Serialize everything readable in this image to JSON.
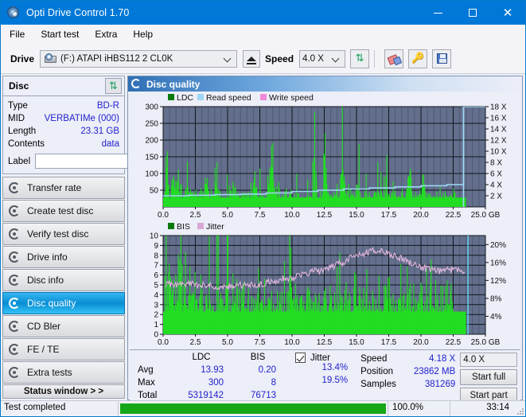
{
  "window": {
    "title": "Opti Drive Control 1.70",
    "icon": "disc-icon",
    "minimize_label": "–",
    "maximize_label": "□",
    "close_label": "✕"
  },
  "menubar": {
    "items": [
      {
        "label": "File"
      },
      {
        "label": "Start test"
      },
      {
        "label": "Extra"
      },
      {
        "label": "Help"
      }
    ]
  },
  "toolbar": {
    "drive_label": "Drive",
    "drive_value": "(F:)  ATAPI iHBS112  2 CL0K",
    "eject_icon": "eject-icon",
    "speed_label": "Speed",
    "speed_value": "4.0 X",
    "refresh_icon": "refresh-icon",
    "eraser_icon": "eraser-icon",
    "key_icon": "key-icon",
    "save_icon": "save-icon"
  },
  "sidebar": {
    "disc_panel": {
      "title": "Disc",
      "refresh_icon": "refresh-disc-icon",
      "rows": [
        {
          "key": "Type",
          "value": "BD-R"
        },
        {
          "key": "MID",
          "value": "VERBATIMe (000)"
        },
        {
          "key": "Length",
          "value": "23.31 GB"
        },
        {
          "key": "Contents",
          "value": "data"
        }
      ],
      "label_key": "Label",
      "label_value": "",
      "label_placeholder": "",
      "label_button_icon": "cd-icon"
    },
    "nav_items": [
      {
        "label": "Transfer rate",
        "icon": "disc-test-icon",
        "active": false
      },
      {
        "label": "Create test disc",
        "icon": "disc-test-icon",
        "active": false
      },
      {
        "label": "Verify test disc",
        "icon": "disc-test-icon",
        "active": false
      },
      {
        "label": "Drive info",
        "icon": "disc-test-icon",
        "active": false
      },
      {
        "label": "Disc info",
        "icon": "disc-test-icon",
        "active": false
      },
      {
        "label": "Disc quality",
        "icon": "disc-test-icon",
        "active": true
      },
      {
        "label": "CD Bler",
        "icon": "disc-test-icon",
        "active": false
      },
      {
        "label": "FE / TE",
        "icon": "disc-test-icon",
        "active": false
      },
      {
        "label": "Extra tests",
        "icon": "disc-test-icon",
        "active": false
      }
    ],
    "status_window_button": "Status window > >"
  },
  "main": {
    "panel_title": "Disc quality",
    "panel_icon": "disc-quality-icon"
  },
  "stats": {
    "col_headers": [
      "",
      "LDC",
      "BIS"
    ],
    "rows": [
      {
        "key": "Avg",
        "ldc": "13.93",
        "bis": "0.20"
      },
      {
        "key": "Max",
        "ldc": "300",
        "bis": "8"
      },
      {
        "key": "Total",
        "ldc": "5319142",
        "bis": "76713"
      }
    ],
    "jitter": {
      "checked": true,
      "label": "Jitter",
      "avg": "13.4%",
      "max": "19.5%"
    },
    "speed": {
      "key": "Speed",
      "value": "4.18 X"
    },
    "position": {
      "key": "Position",
      "value": "23862 MB"
    },
    "samples": {
      "key": "Samples",
      "value": "381269"
    },
    "speed_select": "4.0 X",
    "start_full_button": "Start full",
    "start_part_button": "Start part"
  },
  "statusbar": {
    "message": "Test completed",
    "progress_percent": "100.0%",
    "progress_value": 100,
    "elapsed": "33:14"
  },
  "colors": {
    "accent": "#0078d7",
    "plot_bg": "#636f8c",
    "ldc_green": "#22dd22",
    "bis_green": "#22dd22",
    "read_speed_blue": "#9fe0f8",
    "write_speed_pink": "#ef8fe0",
    "jitter_pink": "#e3b6dd",
    "value_blue": "#2222cc",
    "progress_green": "#16a716"
  },
  "chart_data": [
    {
      "type": "line",
      "title": "Disc quality - LDC / Read speed",
      "xlabel": "GB",
      "ylabel": "LDC",
      "y2label": "X",
      "xlim": [
        0,
        25
      ],
      "ylim": [
        0,
        300
      ],
      "y2lim": [
        0,
        18
      ],
      "xticks": [
        "0.0",
        "2.5",
        "5.0",
        "7.5",
        "10.0",
        "12.5",
        "15.0",
        "17.5",
        "20.0",
        "22.5",
        "25.0 GB"
      ],
      "yticks": [
        "50",
        "100",
        "150",
        "200",
        "250",
        "300"
      ],
      "y2ticks": [
        "2 X",
        "4 X",
        "6 X",
        "8 X",
        "10 X",
        "12 X",
        "14 X",
        "16 X",
        "18 X"
      ],
      "grid": true,
      "legend_position": "top-left",
      "legend": [
        {
          "name": "LDC",
          "color": "#0a7a0a"
        },
        {
          "name": "Read speed",
          "color": "#9fd6f5"
        },
        {
          "name": "Write speed",
          "color": "#f08ad8"
        }
      ],
      "series": [
        {
          "name": "LDC",
          "color": "#22dd22",
          "kind": "impulse",
          "x": [
            0.1,
            0.3,
            0.5,
            0.7,
            0.9,
            1.1,
            1.3,
            1.5,
            1.7,
            1.9,
            2.1,
            2.3,
            2.5,
            2.7,
            2.9,
            3.1,
            3.3,
            3.5,
            3.7,
            3.9,
            4.1,
            4.3,
            4.5,
            4.7,
            4.9,
            5.1,
            5.3,
            5.5,
            5.7,
            5.9,
            6.1,
            6.3,
            6.5,
            6.7,
            6.9,
            7.1,
            7.3,
            7.5,
            7.7,
            7.9,
            8.1,
            8.3,
            8.5,
            8.7,
            8.9,
            9.1,
            9.3,
            9.5,
            9.7,
            9.9,
            10.1,
            10.3,
            10.5,
            10.7,
            10.9,
            11.1,
            11.3,
            11.5,
            11.7,
            11.9,
            12.1,
            12.3,
            12.5,
            12.7,
            12.9,
            13.1,
            13.3,
            13.5,
            13.7,
            13.9,
            14.1,
            14.3,
            14.5,
            14.7,
            14.9,
            15.1,
            15.3,
            15.5,
            15.7,
            15.9,
            16.1,
            16.3,
            16.5,
            16.7,
            16.9,
            17.1,
            17.3,
            17.5,
            17.7,
            17.9,
            18.1,
            18.3,
            18.5,
            18.7,
            18.9,
            19.1,
            19.3,
            19.5,
            19.7,
            19.9,
            20.1,
            20.3,
            20.5,
            20.7,
            20.9,
            21.1,
            21.3,
            21.5,
            21.7,
            21.9,
            22.1,
            22.3,
            22.5,
            22.7,
            22.9,
            23.1,
            23.3,
            23.5
          ],
          "values": [
            95,
            170,
            60,
            85,
            55,
            150,
            52,
            45,
            42,
            60,
            48,
            40,
            55,
            38,
            42,
            36,
            120,
            40,
            34,
            38,
            175,
            36,
            40,
            34,
            48,
            42,
            38,
            120,
            40,
            36,
            34,
            42,
            40,
            36,
            70,
            90,
            44,
            38,
            36,
            40,
            42,
            130,
            180,
            36,
            34,
            38,
            36,
            40,
            34,
            36,
            38,
            34,
            40,
            36,
            34,
            38,
            34,
            36,
            250,
            34,
            36,
            38,
            300,
            40,
            36,
            34,
            36,
            38,
            34,
            190,
            36,
            34,
            38,
            36,
            34,
            120,
            36,
            34,
            40,
            36,
            34,
            36,
            38,
            34,
            36,
            34,
            100,
            36,
            34,
            38,
            36,
            34,
            36,
            38,
            34,
            130,
            36,
            34,
            36,
            38,
            120,
            36,
            34,
            36,
            38,
            34,
            36,
            34,
            38,
            36,
            34,
            36,
            34,
            36
          ]
        },
        {
          "name": "Read speed",
          "color": "#9fd6f5",
          "kind": "step",
          "x": [
            0,
            2,
            4,
            6,
            8,
            10,
            12,
            14,
            16,
            18,
            20,
            22,
            23.3
          ],
          "values": [
            2.0,
            2.1,
            2.2,
            2.3,
            2.5,
            2.8,
            3.0,
            3.2,
            3.4,
            3.6,
            3.8,
            4.0,
            18.0
          ]
        }
      ]
    },
    {
      "type": "line",
      "title": "Disc quality - BIS / Jitter",
      "xlabel": "GB",
      "ylabel": "BIS",
      "y2label": "%",
      "xlim": [
        0,
        25
      ],
      "ylim": [
        0,
        10
      ],
      "y2lim": [
        0,
        22
      ],
      "xticks": [
        "0.0",
        "2.5",
        "5.0",
        "7.5",
        "10.0",
        "12.5",
        "15.0",
        "17.5",
        "20.0",
        "22.5",
        "25.0 GB"
      ],
      "yticks": [
        "0",
        "1",
        "2",
        "3",
        "4",
        "5",
        "6",
        "7",
        "8",
        "9",
        "10"
      ],
      "y2ticks": [
        "4%",
        "8%",
        "12%",
        "16%",
        "20%"
      ],
      "grid": true,
      "legend_position": "top-left",
      "legend": [
        {
          "name": "BIS",
          "color": "#0a7a0a"
        },
        {
          "name": "Jitter",
          "color": "#d9a8d4"
        }
      ],
      "series": [
        {
          "name": "BIS",
          "color": "#22dd22",
          "kind": "impulse",
          "x": [
            0.1,
            0.3,
            0.5,
            0.7,
            0.9,
            1.1,
            1.3,
            1.5,
            1.7,
            1.9,
            2.1,
            2.3,
            2.5,
            2.7,
            2.9,
            3.1,
            3.3,
            3.5,
            3.7,
            3.9,
            4.1,
            4.3,
            4.5,
            4.7,
            4.9,
            5.1,
            5.3,
            5.5,
            5.7,
            5.9,
            6.1,
            6.3,
            6.5,
            6.7,
            6.9,
            7.1,
            7.3,
            7.5,
            7.7,
            7.9,
            8.1,
            8.3,
            8.5,
            8.7,
            8.9,
            9.1,
            9.3,
            9.5,
            9.7,
            9.9,
            10.1,
            10.3,
            10.5,
            10.7,
            10.9,
            11.1,
            11.3,
            11.5,
            11.7,
            11.9,
            12.1,
            12.3,
            12.5,
            12.7,
            12.9,
            13.1,
            13.3,
            13.5,
            13.7,
            13.9,
            14.1,
            14.3,
            14.5,
            14.7,
            14.9,
            15.1,
            15.3,
            15.5,
            15.7,
            15.9,
            16.1,
            16.3,
            16.5,
            16.7,
            16.9,
            17.1,
            17.3,
            17.5,
            17.7,
            17.9,
            18.1,
            18.3,
            18.5,
            18.7,
            18.9,
            19.1,
            19.3,
            19.5,
            19.7,
            19.9,
            20.1,
            20.3,
            20.5,
            20.7,
            20.9,
            21.1,
            21.3,
            21.5,
            21.7,
            21.9,
            22.1,
            22.3,
            22.5,
            22.7,
            22.9,
            23.1,
            23.3,
            23.5
          ],
          "values": [
            6,
            5,
            6,
            8,
            4,
            7,
            7,
            4,
            5,
            4,
            3,
            4,
            3,
            4,
            5,
            3,
            4,
            3,
            4,
            3,
            4,
            5,
            3,
            4,
            7,
            3,
            4,
            3,
            4,
            3,
            4,
            3,
            5,
            3,
            4,
            3,
            4,
            3,
            4,
            5,
            3,
            4,
            3,
            4,
            3,
            4,
            3,
            4,
            3,
            5,
            3,
            4,
            3,
            4,
            3,
            4,
            5,
            3,
            4,
            3,
            4,
            3,
            4,
            3,
            5,
            3,
            4,
            3,
            4,
            3,
            5,
            3,
            4,
            3,
            6,
            3,
            4,
            3,
            4,
            3,
            6,
            3,
            4,
            5,
            3,
            4,
            5,
            5,
            3,
            4,
            3,
            4,
            3,
            4,
            3,
            4,
            3,
            4,
            3,
            4,
            5,
            3,
            4,
            5,
            3,
            4,
            3,
            4,
            3,
            4,
            3,
            4,
            3,
            4
          ]
        },
        {
          "name": "Jitter",
          "color": "#e3b6dd",
          "kind": "line",
          "x": [
            0.2,
            0.6,
            1.0,
            1.4,
            1.8,
            2.2,
            2.6,
            3.0,
            3.4,
            3.8,
            4.2,
            4.6,
            5.0,
            5.4,
            5.8,
            6.2,
            6.6,
            7.0,
            7.4,
            7.8,
            8.2,
            8.6,
            9.0,
            9.4,
            9.8,
            10.2,
            10.6,
            11.0,
            11.4,
            11.8,
            12.2,
            12.6,
            13.0,
            13.4,
            13.8,
            14.2,
            14.6,
            15.0,
            15.4,
            15.8,
            16.2,
            16.6,
            17.0,
            17.4,
            17.8,
            18.2,
            18.6,
            19.0,
            19.4,
            19.8,
            20.2,
            20.6,
            21.0,
            21.4,
            21.8,
            22.2,
            22.6,
            23.0,
            23.4
          ],
          "values": [
            11.0,
            11.2,
            11.0,
            11.4,
            11.0,
            11.2,
            10.9,
            11.0,
            10.8,
            11.0,
            10.6,
            10.8,
            10.6,
            10.8,
            11.0,
            10.8,
            11.0,
            11.2,
            11.0,
            11.3,
            11.6,
            11.8,
            12.0,
            12.6,
            12.4,
            12.8,
            13.2,
            13.4,
            13.8,
            14.2,
            14.0,
            14.6,
            15.0,
            15.4,
            15.8,
            16.4,
            17.0,
            17.4,
            17.8,
            18.2,
            18.6,
            18.2,
            18.6,
            18.0,
            17.6,
            17.2,
            16.8,
            16.2,
            15.8,
            15.2,
            14.8,
            14.4,
            14.2,
            14.0,
            14.4,
            14.2,
            14.6,
            14.4,
            14.2
          ]
        }
      ]
    }
  ]
}
